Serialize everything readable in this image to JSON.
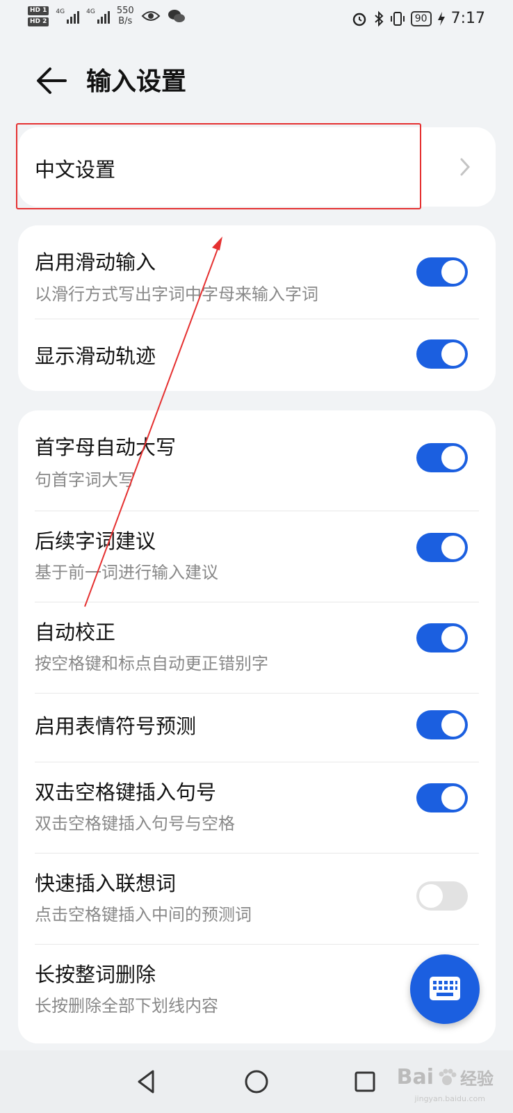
{
  "status_bar": {
    "hd1": "HD 1",
    "hd2": "HD 2",
    "net1": "4G",
    "net2": "4G",
    "speed_value": "550",
    "speed_unit": "B/s",
    "battery": "90",
    "time": "7:17"
  },
  "header": {
    "title": "输入设置"
  },
  "chinese_settings": {
    "label": "中文设置"
  },
  "swipe_group": [
    {
      "label": "启用滑动输入",
      "desc": "以滑行方式写出字词中字母来输入字词",
      "on": true
    },
    {
      "label": "显示滑动轨迹",
      "desc": "",
      "on": true
    }
  ],
  "general_group": [
    {
      "label": "首字母自动大写",
      "desc": "句首字词大写",
      "on": true
    },
    {
      "label": "后续字词建议",
      "desc": "基于前一词进行输入建议",
      "on": true
    },
    {
      "label": "自动校正",
      "desc": "按空格键和标点自动更正错别字",
      "on": true
    },
    {
      "label": "启用表情符号预测",
      "desc": "",
      "on": true
    },
    {
      "label": "双击空格键插入句号",
      "desc": "双击空格键插入句号与空格",
      "on": true
    },
    {
      "label": "快速插入联想词",
      "desc": "点击空格键插入中间的预测词",
      "on": false
    },
    {
      "label": "长按整词删除",
      "desc": "长按删除全部下划线内容"
    }
  ],
  "watermark": {
    "brand": "Bai",
    "brand2": "经验",
    "url": "jingyan.baidu.com"
  },
  "colors": {
    "accent": "#1b5fe0",
    "highlight": "#e53030",
    "background": "#f1f3f5"
  }
}
